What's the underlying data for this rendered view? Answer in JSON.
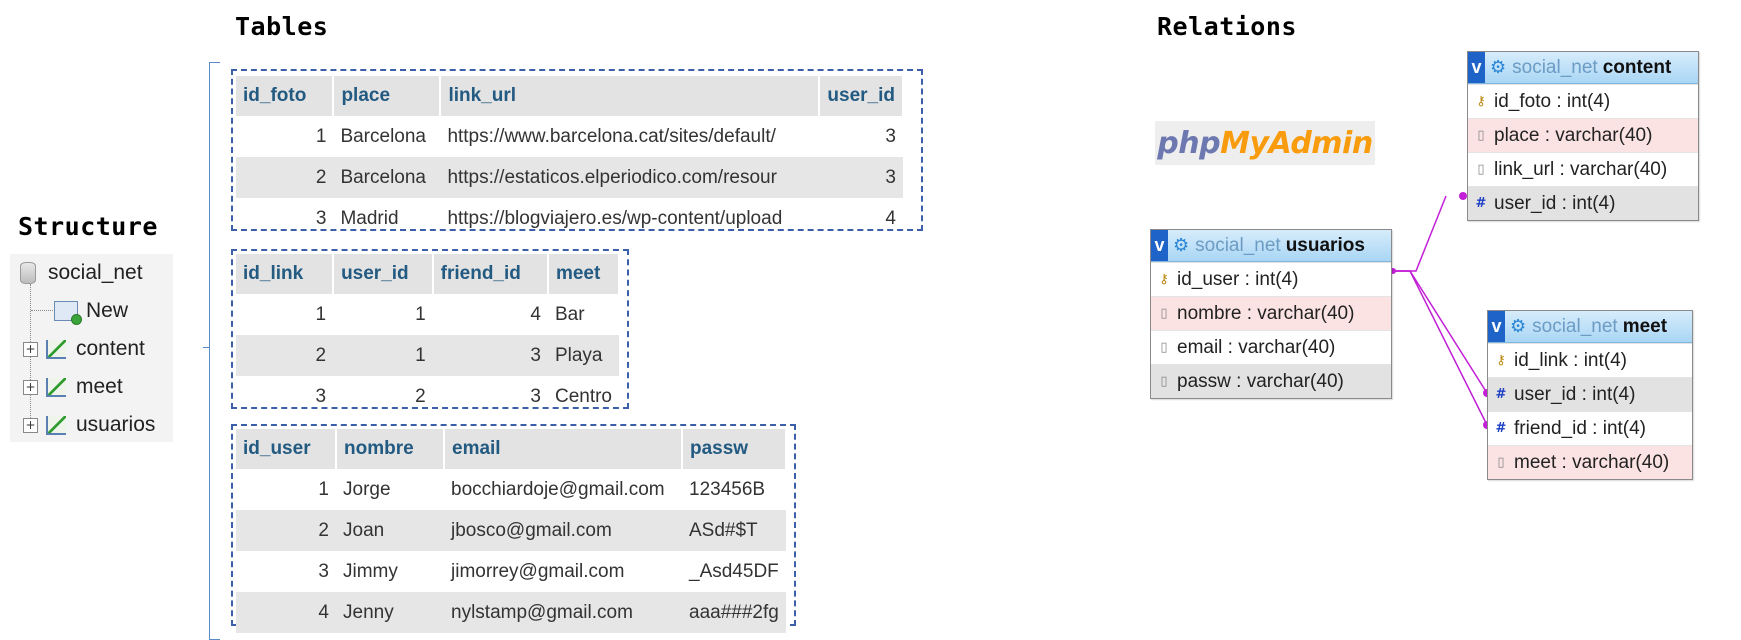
{
  "headings": {
    "tables": "Tables",
    "relations": "Relations",
    "structure": "Structure"
  },
  "tree": {
    "database": "social_net",
    "new_label": "New",
    "tables": [
      "content",
      "meet",
      "usuarios"
    ]
  },
  "content_table": {
    "columns": [
      "id_foto",
      "place",
      "link_url",
      "user_id"
    ],
    "rows": [
      [
        "1",
        "Barcelona",
        "https://www.barcelona.cat/sites/default/",
        "3"
      ],
      [
        "2",
        "Barcelona",
        "https://estaticos.elperiodico.com/resour",
        "3"
      ],
      [
        "3",
        "Madrid",
        "https://blogviajero.es/wp-content/upload",
        "4"
      ]
    ]
  },
  "meet_table": {
    "columns": [
      "id_link",
      "user_id",
      "friend_id",
      "meet"
    ],
    "rows": [
      [
        "1",
        "1",
        "4",
        "Bar"
      ],
      [
        "2",
        "1",
        "3",
        "Playa"
      ],
      [
        "3",
        "2",
        "3",
        "Centro"
      ]
    ]
  },
  "usuarios_table": {
    "columns": [
      "id_user",
      "nombre",
      "email",
      "passw"
    ],
    "rows": [
      [
        "1",
        "Jorge",
        "bocchiardoje@gmail.com",
        "123456B"
      ],
      [
        "2",
        "Joan",
        "jbosco@gmail.com",
        "ASd#$T"
      ],
      [
        "3",
        "Jimmy",
        "jimorrey@gmail.com",
        "_Asd45DF"
      ],
      [
        "4",
        "Jenny",
        "nylstamp@gmail.com",
        "aaa###2fg"
      ]
    ]
  },
  "logo": {
    "part1": "php",
    "part2": "MyAdmin"
  },
  "relations": {
    "badge": "v",
    "db": "social_net",
    "content": {
      "name": "content",
      "fields": [
        {
          "label": "id_foto : int(4)",
          "kind": "key"
        },
        {
          "label": "place : varchar(40)",
          "kind": "text"
        },
        {
          "label": "link_url : varchar(40)",
          "kind": "plain"
        },
        {
          "label": "user_id : int(4)",
          "kind": "fk"
        }
      ]
    },
    "usuarios": {
      "name": "usuarios",
      "fields": [
        {
          "label": "id_user : int(4)",
          "kind": "key"
        },
        {
          "label": "nombre : varchar(40)",
          "kind": "text"
        },
        {
          "label": "email : varchar(40)",
          "kind": "plain"
        },
        {
          "label": "passw : varchar(40)",
          "kind": "fk-plain"
        }
      ]
    },
    "meet": {
      "name": "meet",
      "fields": [
        {
          "label": "id_link : int(4)",
          "kind": "key"
        },
        {
          "label": "user_id : int(4)",
          "kind": "fk"
        },
        {
          "label": "friend_id : int(4)",
          "kind": "fk"
        },
        {
          "label": "meet : varchar(40)",
          "kind": "text"
        }
      ]
    },
    "link_color": "#c21fd6"
  }
}
